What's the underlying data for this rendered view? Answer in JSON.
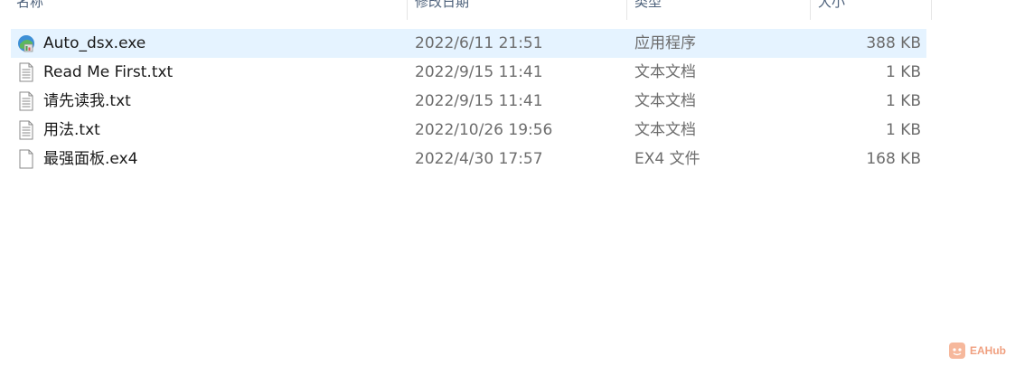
{
  "columns": {
    "name": "名称",
    "date": "修改日期",
    "type": "类型",
    "size": "大小"
  },
  "files": [
    {
      "name": "Auto_dsx.exe",
      "date": "2022/6/11 21:51",
      "type": "应用程序",
      "size": "388 KB",
      "icon": "exe-app-icon",
      "selected": true
    },
    {
      "name": "Read Me First.txt",
      "date": "2022/9/15 11:41",
      "type": "文本文档",
      "size": "1 KB",
      "icon": "text-document-icon",
      "selected": false
    },
    {
      "name": "请先读我.txt",
      "date": "2022/9/15 11:41",
      "type": "文本文档",
      "size": "1 KB",
      "icon": "text-document-icon",
      "selected": false
    },
    {
      "name": "用法.txt",
      "date": "2022/10/26 19:56",
      "type": "文本文档",
      "size": "1 KB",
      "icon": "text-document-icon",
      "selected": false
    },
    {
      "name": "最强面板.ex4",
      "date": "2022/4/30 17:57",
      "type": "EX4 文件",
      "size": "168 KB",
      "icon": "blank-file-icon",
      "selected": false
    }
  ],
  "watermark": {
    "text": "EAHub"
  },
  "colors": {
    "selection": "#e5f3ff",
    "header_text": "#4c607a",
    "secondary_text": "#6d6d6d"
  }
}
